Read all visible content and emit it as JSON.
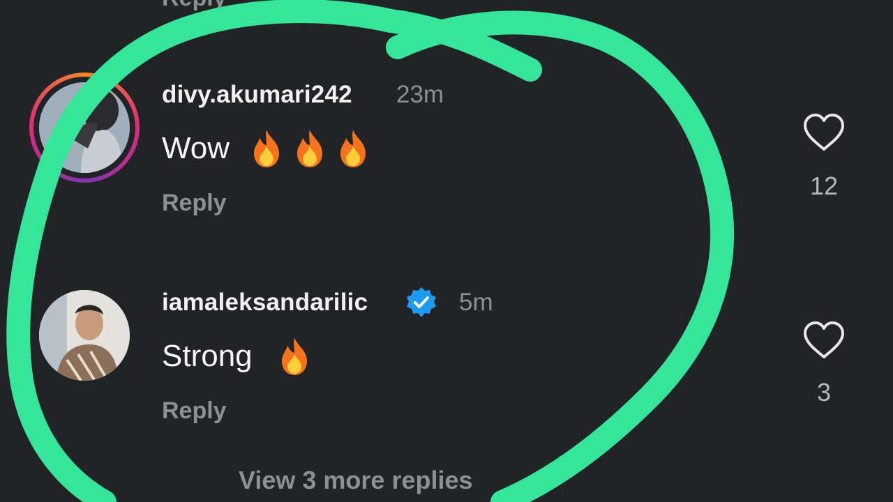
{
  "partial_top": {
    "reply_label": "Reply"
  },
  "comments": [
    {
      "username": "divy.akumari242",
      "timestamp": "23m",
      "text": "Wow",
      "emoji_count": 3,
      "reply_label": "Reply",
      "likes": "12",
      "verified": false,
      "story_ring": true
    },
    {
      "username": "iamaleksandarilic",
      "timestamp": "5m",
      "text": "Strong",
      "emoji_count": 1,
      "reply_label": "Reply",
      "likes": "3",
      "verified": true,
      "story_ring": false
    }
  ],
  "view_more_replies": "View 3 more replies",
  "colors": {
    "background": "#222327",
    "muted_text": "#8e8f93",
    "verified_badge": "#1d9bf0",
    "highlight_stroke": "#35e59a"
  },
  "icons": [
    "heart-outline-icon",
    "verified-badge-icon",
    "fire-emoji"
  ]
}
